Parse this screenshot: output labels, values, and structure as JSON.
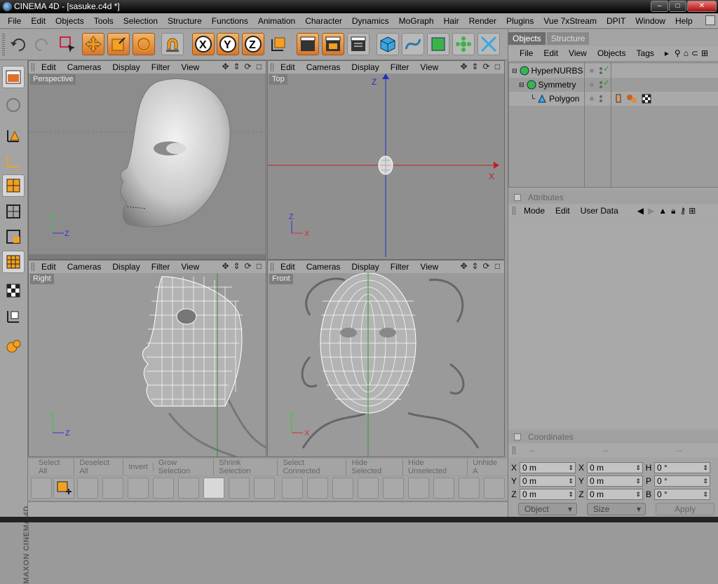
{
  "window": {
    "title": "CINEMA 4D - [sasuke.c4d *]"
  },
  "menu": [
    "File",
    "Edit",
    "Objects",
    "Tools",
    "Selection",
    "Structure",
    "Functions",
    "Animation",
    "Character",
    "Dynamics",
    "MoGraph",
    "Hair",
    "Render",
    "Plugins",
    "Vue 7xStream",
    "DPIT",
    "Window",
    "Help"
  ],
  "viewport_menu": [
    "Edit",
    "Cameras",
    "Display",
    "Filter",
    "View"
  ],
  "viewports": {
    "perspective": {
      "label": "Perspective"
    },
    "top": {
      "label": "Top"
    },
    "right": {
      "label": "Right"
    },
    "front": {
      "label": "Front"
    }
  },
  "axes": {
    "x": "X",
    "y": "Y",
    "z": "Z"
  },
  "toolbar_icons": [
    "undo-icon",
    "redo-icon",
    "select-icon",
    "move-icon",
    "scale-icon",
    "rotate-icon",
    "magnet-icon",
    "x-axis-icon",
    "y-axis-icon",
    "z-axis-icon",
    "coordinate-system-icon",
    "render-view-icon",
    "render-picture-viewer-icon",
    "render-settings-icon",
    "cube-icon",
    "spline-icon",
    "nurbs-icon",
    "array-icon",
    "deformer-icon"
  ],
  "left_icons": [
    "layout-icon",
    "texture-mode-icon",
    "points-mode-icon",
    "edges-mode-icon",
    "polygons-mode-icon",
    "model-mode-icon",
    "object-mode-icon",
    "animation-mode-icon",
    "checker-icon",
    "workplane-icon",
    "sculpt-icon"
  ],
  "bottom_bar": [
    "Select All",
    "Deselect All",
    "Invert",
    "Grow Selection",
    "Shrink Selection",
    "Select Connected",
    "Hide Selected",
    "Hide Unselected",
    "Unhide A"
  ],
  "maxon_logo": "MAXON CINEMA 4D",
  "right_panel": {
    "tabs": [
      "Objects",
      "Structure"
    ],
    "objects_menu": [
      "File",
      "Edit",
      "View",
      "Objects",
      "Tags"
    ],
    "objects": [
      {
        "name": "HyperNURBS",
        "icon": "hypernurbs-icon"
      },
      {
        "name": "Symmetry",
        "icon": "symmetry-icon"
      },
      {
        "name": "Polygon",
        "icon": "polygon-icon"
      }
    ],
    "attributes_title": "Attributes",
    "attributes_menu": [
      "Mode",
      "Edit",
      "User Data"
    ],
    "coordinates_title": "Coordinates",
    "coords_headers": [
      "--",
      "--",
      "--"
    ],
    "coords": [
      {
        "l1": "X",
        "v1": "0 m",
        "l2": "X",
        "v2": "0 m",
        "l3": "H",
        "v3": "0 °"
      },
      {
        "l1": "Y",
        "v1": "0 m",
        "l2": "Y",
        "v2": "0 m",
        "l3": "P",
        "v3": "0 °"
      },
      {
        "l1": "Z",
        "v1": "0 m",
        "l2": "Z",
        "v2": "0 m",
        "l3": "B",
        "v3": "0 °"
      }
    ],
    "mode_select": "Object",
    "size_select": "Size",
    "apply": "Apply"
  },
  "colors": {
    "selected_orange": "#e08a3a",
    "panel": "#a4a4a4",
    "viewport_bg": "#8f8f8f",
    "x_axis": "#c03030",
    "y_axis": "#30a030",
    "z_axis": "#3030c0"
  }
}
